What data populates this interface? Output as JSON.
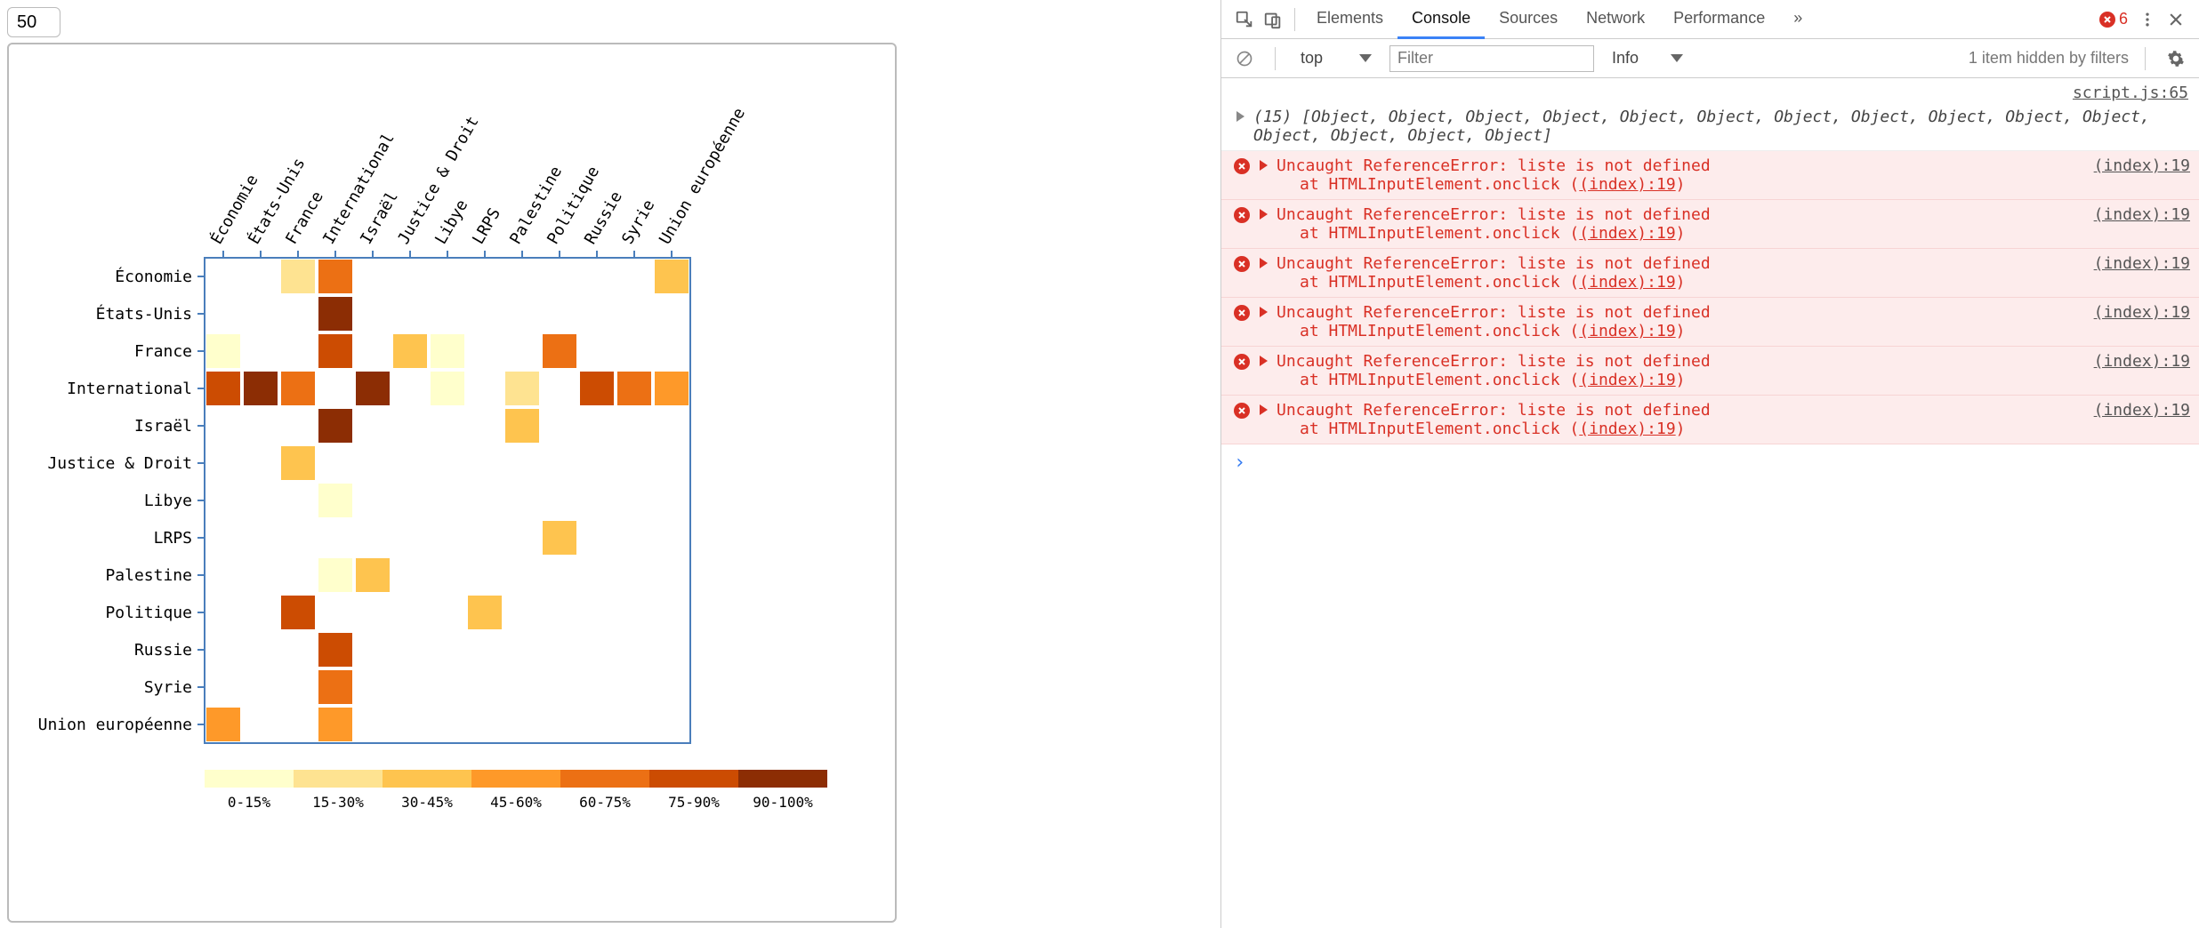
{
  "input_value": "50",
  "devtools": {
    "tabs": [
      "Elements",
      "Console",
      "Sources",
      "Network",
      "Performance"
    ],
    "active_tab": "Console",
    "overflow_glyph": "»",
    "error_count": "6",
    "toolbar": {
      "context": "top",
      "filter_placeholder": "Filter",
      "level": "Info",
      "hidden_note": "1 item hidden by filters"
    },
    "log_source": "script.js:65",
    "log_text": "(15) [Object, Object, Object, Object, Object, Object, Object, Object, Object, Object, Object, Object, Object, Object, Object]",
    "error": {
      "line1": "Uncaught ReferenceError: liste is not defined",
      "line2_prefix": "at HTMLInputElement.onclick (",
      "line2_link": "(index):19",
      "line2_suffix": ")",
      "source": "(index):19",
      "count": 6
    }
  },
  "chart_data": {
    "type": "heatmap",
    "categories": [
      "Économie",
      "États-Unis",
      "France",
      "International",
      "Israël",
      "Justice & Droit",
      "Libye",
      "LRPS",
      "Palestine",
      "Politique",
      "Russie",
      "Syrie",
      "Union européenne"
    ],
    "legend": {
      "labels": [
        "0-15%",
        "15-30%",
        "30-45%",
        "45-60%",
        "60-75%",
        "75-90%",
        "90-100%"
      ],
      "colors": [
        "#ffffcc",
        "#fee391",
        "#fec44f",
        "#fe9929",
        "#ec7014",
        "#cc4c02",
        "#8c2d04"
      ]
    },
    "cells": [
      {
        "row": "Économie",
        "col": "France",
        "color": "#fee391"
      },
      {
        "row": "Économie",
        "col": "International",
        "color": "#ec7014"
      },
      {
        "row": "Économie",
        "col": "Union européenne",
        "color": "#fec44f"
      },
      {
        "row": "États-Unis",
        "col": "International",
        "color": "#8c2d04"
      },
      {
        "row": "France",
        "col": "Économie",
        "color": "#ffffcc"
      },
      {
        "row": "France",
        "col": "International",
        "color": "#cc4c02"
      },
      {
        "row": "France",
        "col": "Justice & Droit",
        "color": "#fec44f"
      },
      {
        "row": "France",
        "col": "Libye",
        "color": "#ffffcc"
      },
      {
        "row": "France",
        "col": "Politique",
        "color": "#ec7014"
      },
      {
        "row": "International",
        "col": "Économie",
        "color": "#cc4c02"
      },
      {
        "row": "International",
        "col": "États-Unis",
        "color": "#8c2d04"
      },
      {
        "row": "International",
        "col": "France",
        "color": "#ec7014"
      },
      {
        "row": "International",
        "col": "Israël",
        "color": "#8c2d04"
      },
      {
        "row": "International",
        "col": "Libye",
        "color": "#ffffcc"
      },
      {
        "row": "International",
        "col": "Palestine",
        "color": "#fee391"
      },
      {
        "row": "International",
        "col": "Russie",
        "color": "#cc4c02"
      },
      {
        "row": "International",
        "col": "Syrie",
        "color": "#ec7014"
      },
      {
        "row": "International",
        "col": "Union européenne",
        "color": "#fe9929"
      },
      {
        "row": "Israël",
        "col": "International",
        "color": "#8c2d04"
      },
      {
        "row": "Israël",
        "col": "Palestine",
        "color": "#fec44f"
      },
      {
        "row": "Justice & Droit",
        "col": "France",
        "color": "#fec44f"
      },
      {
        "row": "Libye",
        "col": "International",
        "color": "#ffffcc"
      },
      {
        "row": "LRPS",
        "col": "Politique",
        "color": "#fec44f"
      },
      {
        "row": "Palestine",
        "col": "International",
        "color": "#ffffcc"
      },
      {
        "row": "Palestine",
        "col": "Israël",
        "color": "#fec44f"
      },
      {
        "row": "Politique",
        "col": "France",
        "color": "#cc4c02"
      },
      {
        "row": "Politique",
        "col": "LRPS",
        "color": "#fec44f"
      },
      {
        "row": "Russie",
        "col": "International",
        "color": "#cc4c02"
      },
      {
        "row": "Syrie",
        "col": "International",
        "color": "#ec7014"
      },
      {
        "row": "Union européenne",
        "col": "Économie",
        "color": "#fe9929"
      },
      {
        "row": "Union européenne",
        "col": "International",
        "color": "#fe9929"
      }
    ]
  }
}
